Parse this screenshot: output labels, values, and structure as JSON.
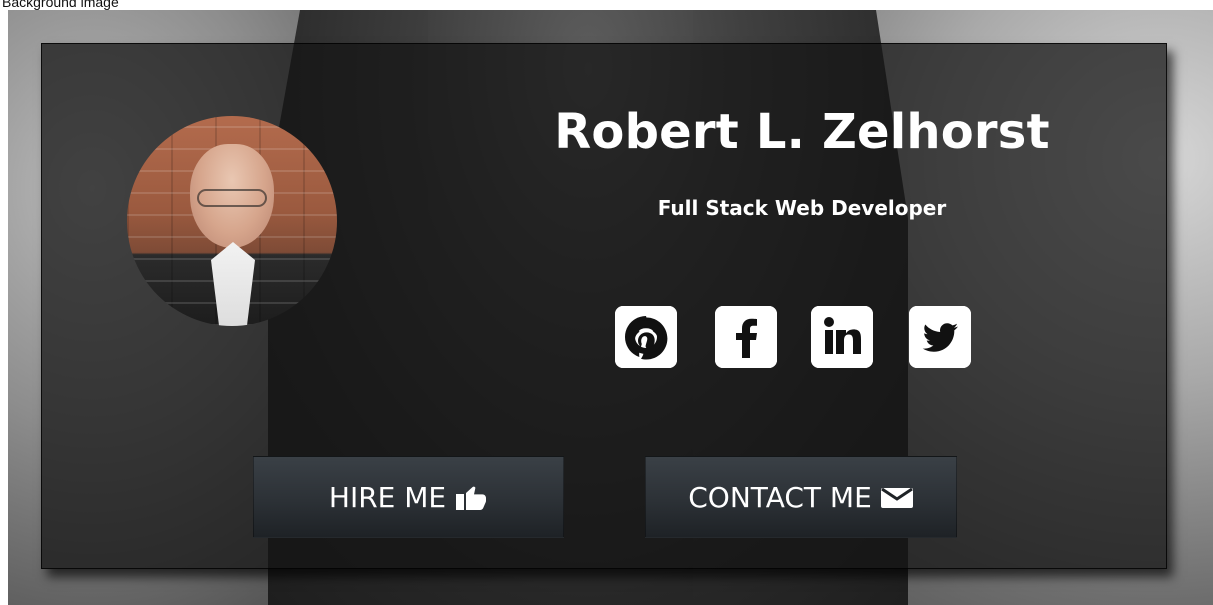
{
  "header": {
    "top_text": "Background image"
  },
  "profile": {
    "name": "Robert L. Zelhorst",
    "role": "Full Stack Web Developer"
  },
  "social": [
    {
      "name": "github",
      "icon": "github-icon"
    },
    {
      "name": "facebook",
      "icon": "facebook-icon"
    },
    {
      "name": "linkedin",
      "icon": "linkedin-icon"
    },
    {
      "name": "twitter",
      "icon": "twitter-icon"
    }
  ],
  "actions": {
    "hire_label": "HIRE ME",
    "contact_label": "CONTACT ME"
  },
  "colors": {
    "card_overlay": "#141414",
    "button_top": "#3A4046",
    "button_bottom": "#1E2226",
    "text": "#FFFFFF"
  }
}
